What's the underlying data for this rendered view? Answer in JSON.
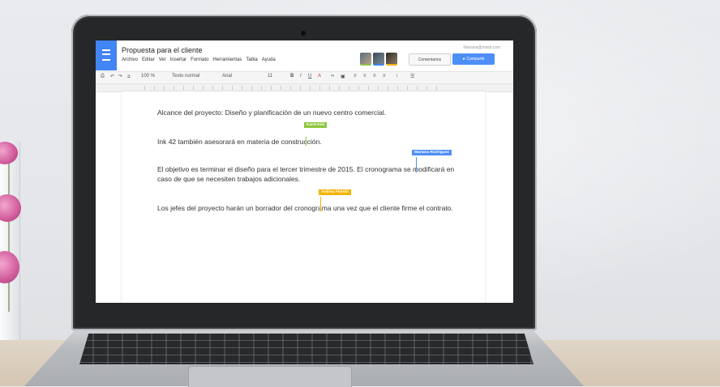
{
  "document": {
    "title": "Propuesta para el cliente",
    "user_email": "Mariana@mixdi.com"
  },
  "menu": [
    "Archivo",
    "Editar",
    "Ver",
    "Insertar",
    "Formato",
    "Herramientas",
    "Tabla",
    "Ayuda"
  ],
  "toolbar": {
    "zoom": "100 %",
    "style": "Texto normal",
    "font": "Arial",
    "size": "11"
  },
  "buttons": {
    "comments": "Comentarios",
    "share": "Compartir"
  },
  "collaborators": [
    {
      "name": "Karel Kim",
      "color": "#8dc63f"
    },
    {
      "name": "Mariana Rodríguez",
      "color": "#4d8ef7"
    },
    {
      "name": "Andrea Flombi",
      "color": "#f4b400"
    }
  ],
  "content": {
    "p1": "Alcance del proyecto: Diseño y planificación de un nuevo centro comercial.",
    "p2": "Ink 42 también asesorará en materia de construcción.",
    "p3": "El objetivo es terminar el diseño para el tercer trimestre de 2015. El cronograma se modificará en caso de que se necesiten trabajos adicionales.",
    "p4": "Los jefes del proyecto harán un borrador del cronograma una vez que el cliente firme el contrato."
  }
}
